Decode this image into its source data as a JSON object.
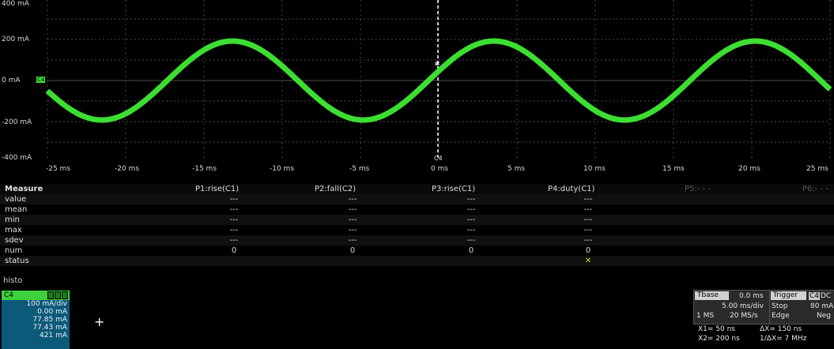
{
  "scope": {
    "channel_tag": "C4",
    "trigger_marker": "C4",
    "y_ticks": [
      "400 mA",
      "200 mA",
      "0 mA",
      "-200 mA",
      "-400 mA"
    ],
    "x_ticks": [
      "-25 ms",
      "-20 ms",
      "-15 ms",
      "-10 ms",
      "-5 ms",
      "0 ms",
      "5 ms",
      "10 ms",
      "15 ms",
      "20 ms",
      "25 ms"
    ],
    "trace_color": "#3dde32",
    "grid_color": "#4a4a4a"
  },
  "measure": {
    "title": "Measure",
    "headers": [
      "P1:rise(C1)",
      "P2:fall(C2)",
      "P3:rise(C1)",
      "P4:duty(C1)",
      "P5:- - -",
      "P6:- - -"
    ],
    "rows": [
      {
        "label": "value",
        "cells": [
          "---",
          "---",
          "---",
          "---"
        ]
      },
      {
        "label": "mean",
        "cells": [
          "---",
          "---",
          "---",
          "---"
        ]
      },
      {
        "label": "min",
        "cells": [
          "---",
          "---",
          "---",
          "---"
        ]
      },
      {
        "label": "max",
        "cells": [
          "---",
          "---",
          "---",
          "---"
        ]
      },
      {
        "label": "sdev",
        "cells": [
          "---",
          "---",
          "---",
          "---"
        ]
      },
      {
        "label": "num",
        "cells": [
          "0",
          "0",
          "0",
          "0"
        ]
      },
      {
        "label": "status",
        "cells": [
          "",
          "",
          "",
          "✕"
        ]
      }
    ]
  },
  "histo": {
    "label": "histo"
  },
  "c4_panel": {
    "title": "C4",
    "lines": [
      "100 mA/div",
      "0.00 mA",
      "77.85 mA",
      "77.43 mA",
      "421 mA"
    ]
  },
  "timebase": {
    "tbase_label": "Tbase",
    "tbase_value": "0.0 ms",
    "trigger_label": "Trigger",
    "trigger_ch": "C4",
    "trigger_mode": "DC",
    "row1_left": "5.00 ms/div",
    "row1_right": "Stop",
    "row1_val": "80 mA",
    "row2_left": "1 MS",
    "row2_mid": "20 MS/s",
    "row2_right": "Edge",
    "row2_val": "Neg",
    "x1": "X1= 50 ns",
    "dx": "ΔX= 150 ns",
    "x2": "X2= 200 ns",
    "inv_dx": "1/ΔX= 7 MHz"
  }
}
